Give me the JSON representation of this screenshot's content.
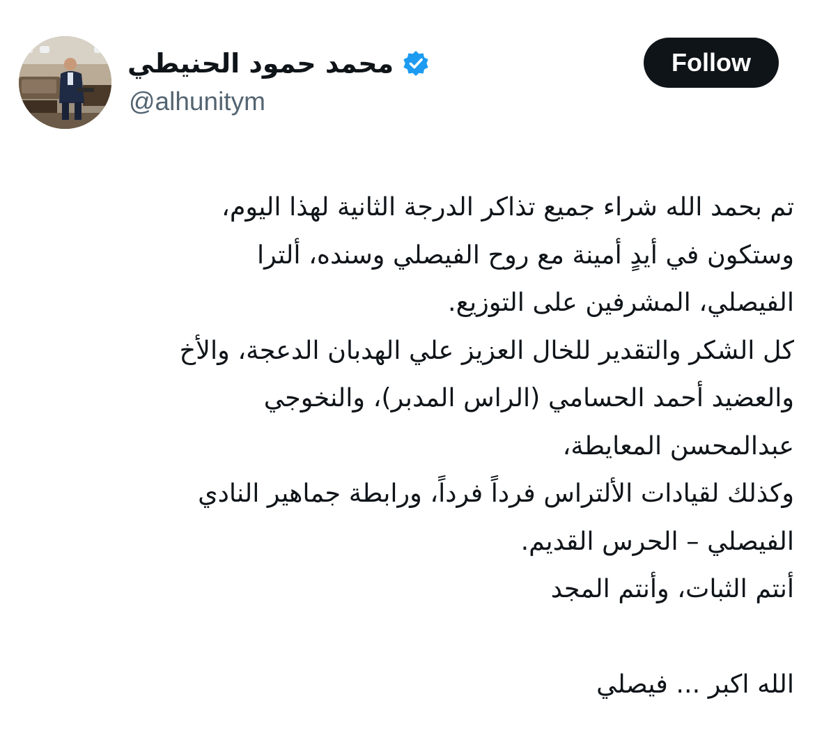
{
  "author": {
    "display_name": "محمد حمود الحنيطي",
    "handle": "@alhunitym",
    "verified": true,
    "avatar_icon": "profile-photo",
    "verified_icon": "verified-badge-icon",
    "verified_color": "#1d9bf0"
  },
  "follow_button": {
    "label": "Follow",
    "background": "#0f1419",
    "text_color": "#ffffff"
  },
  "tweet": {
    "lines": [
      "تم بحمد الله شراء جميع تذاكر الدرجة الثانية لهذا اليوم،",
      "وستكون في أيدٍ أمينة مع روح الفيصلي وسنده، ألترا",
      "الفيصلي، المشرفين على التوزيع.",
      "كل الشكر والتقدير للخال العزيز علي الهدبان الدعجة، والأخ",
      "والعضيد أحمد الحسامي (الراس المدبر)، والنخوجي",
      "عبدالمحسن المعايطة،",
      "وكذلك لقيادات الألتراس فرداً فرداً، ورابطة جماهير النادي",
      "الفيصلي – الحرس القديم.",
      "أنتم الثبات، وأنتم المجد",
      "",
      "الله اكبر ... فيصلي"
    ]
  }
}
